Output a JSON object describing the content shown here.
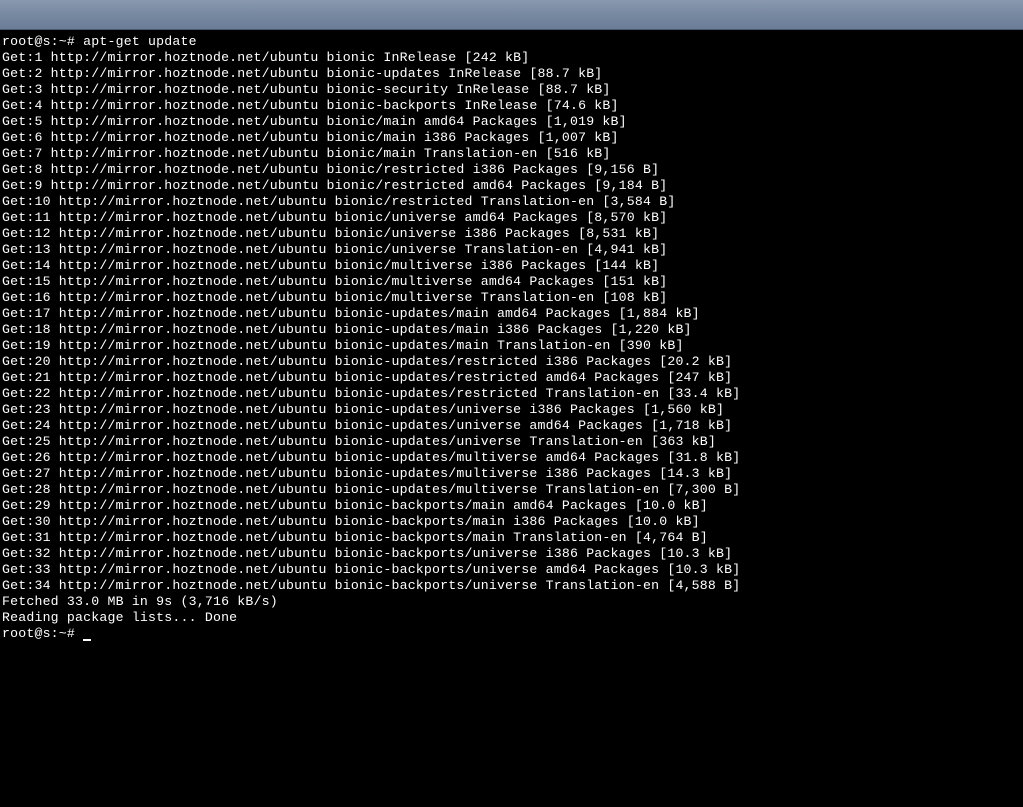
{
  "titlebar": "",
  "terminal": {
    "prompt1": "root@s:~# ",
    "command": "apt-get update",
    "lines": [
      "Get:1 http://mirror.hoztnode.net/ubuntu bionic InRelease [242 kB]",
      "Get:2 http://mirror.hoztnode.net/ubuntu bionic-updates InRelease [88.7 kB]",
      "Get:3 http://mirror.hoztnode.net/ubuntu bionic-security InRelease [88.7 kB]",
      "Get:4 http://mirror.hoztnode.net/ubuntu bionic-backports InRelease [74.6 kB]",
      "Get:5 http://mirror.hoztnode.net/ubuntu bionic/main amd64 Packages [1,019 kB]",
      "Get:6 http://mirror.hoztnode.net/ubuntu bionic/main i386 Packages [1,007 kB]",
      "Get:7 http://mirror.hoztnode.net/ubuntu bionic/main Translation-en [516 kB]",
      "Get:8 http://mirror.hoztnode.net/ubuntu bionic/restricted i386 Packages [9,156 B]",
      "Get:9 http://mirror.hoztnode.net/ubuntu bionic/restricted amd64 Packages [9,184 B]",
      "Get:10 http://mirror.hoztnode.net/ubuntu bionic/restricted Translation-en [3,584 B]",
      "Get:11 http://mirror.hoztnode.net/ubuntu bionic/universe amd64 Packages [8,570 kB]",
      "Get:12 http://mirror.hoztnode.net/ubuntu bionic/universe i386 Packages [8,531 kB]",
      "Get:13 http://mirror.hoztnode.net/ubuntu bionic/universe Translation-en [4,941 kB]",
      "Get:14 http://mirror.hoztnode.net/ubuntu bionic/multiverse i386 Packages [144 kB]",
      "Get:15 http://mirror.hoztnode.net/ubuntu bionic/multiverse amd64 Packages [151 kB]",
      "Get:16 http://mirror.hoztnode.net/ubuntu bionic/multiverse Translation-en [108 kB]",
      "Get:17 http://mirror.hoztnode.net/ubuntu bionic-updates/main amd64 Packages [1,884 kB]",
      "Get:18 http://mirror.hoztnode.net/ubuntu bionic-updates/main i386 Packages [1,220 kB]",
      "Get:19 http://mirror.hoztnode.net/ubuntu bionic-updates/main Translation-en [390 kB]",
      "Get:20 http://mirror.hoztnode.net/ubuntu bionic-updates/restricted i386 Packages [20.2 kB]",
      "Get:21 http://mirror.hoztnode.net/ubuntu bionic-updates/restricted amd64 Packages [247 kB]",
      "Get:22 http://mirror.hoztnode.net/ubuntu bionic-updates/restricted Translation-en [33.4 kB]",
      "Get:23 http://mirror.hoztnode.net/ubuntu bionic-updates/universe i386 Packages [1,560 kB]",
      "Get:24 http://mirror.hoztnode.net/ubuntu bionic-updates/universe amd64 Packages [1,718 kB]",
      "Get:25 http://mirror.hoztnode.net/ubuntu bionic-updates/universe Translation-en [363 kB]",
      "Get:26 http://mirror.hoztnode.net/ubuntu bionic-updates/multiverse amd64 Packages [31.8 kB]",
      "Get:27 http://mirror.hoztnode.net/ubuntu bionic-updates/multiverse i386 Packages [14.3 kB]",
      "Get:28 http://mirror.hoztnode.net/ubuntu bionic-updates/multiverse Translation-en [7,300 B]",
      "Get:29 http://mirror.hoztnode.net/ubuntu bionic-backports/main amd64 Packages [10.0 kB]",
      "Get:30 http://mirror.hoztnode.net/ubuntu bionic-backports/main i386 Packages [10.0 kB]",
      "Get:31 http://mirror.hoztnode.net/ubuntu bionic-backports/main Translation-en [4,764 B]",
      "Get:32 http://mirror.hoztnode.net/ubuntu bionic-backports/universe i386 Packages [10.3 kB]",
      "Get:33 http://mirror.hoztnode.net/ubuntu bionic-backports/universe amd64 Packages [10.3 kB]",
      "Get:34 http://mirror.hoztnode.net/ubuntu bionic-backports/universe Translation-en [4,588 B]",
      "Fetched 33.0 MB in 9s (3,716 kB/s)",
      "Reading package lists... Done"
    ],
    "prompt2": "root@s:~# "
  }
}
